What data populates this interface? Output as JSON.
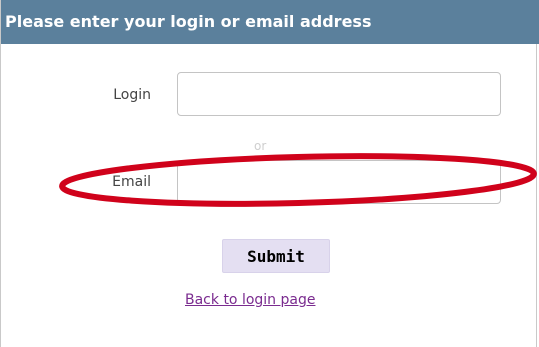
{
  "form": {
    "title": "Please enter your login or email address",
    "login_label": "Login",
    "login_value": "",
    "ghost_text": "or",
    "email_label": "Email",
    "email_value": "",
    "submit_label": "Submit",
    "back_link": "Back to login page"
  },
  "colors": {
    "header_bg": "#5b809c",
    "header_text": "#ffffff",
    "button_bg": "#e4dff2",
    "link": "#7a2b8f",
    "annotation_ellipse": "#d0021b"
  }
}
